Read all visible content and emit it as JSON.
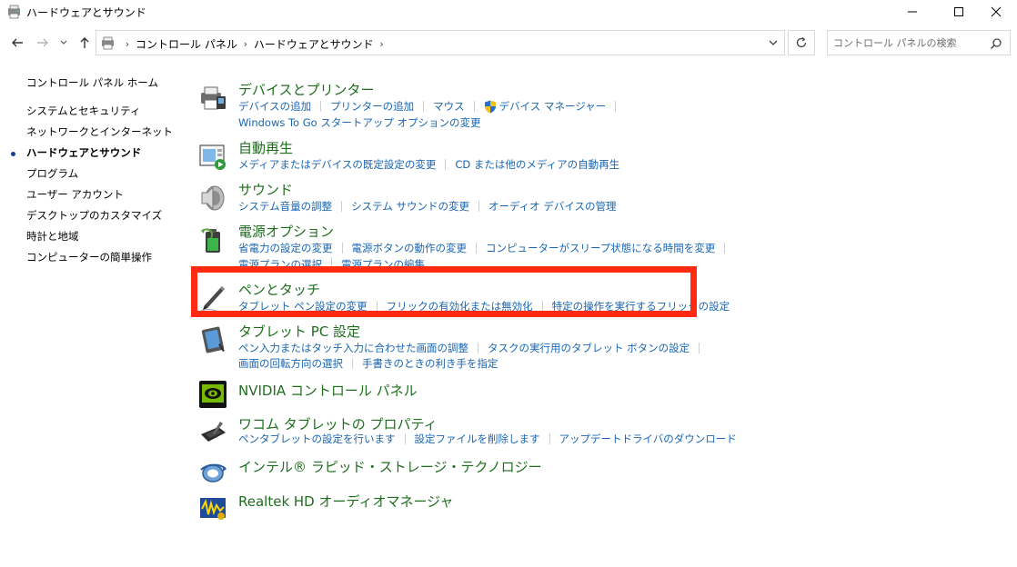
{
  "window": {
    "title": "ハードウェアとサウンド"
  },
  "address": {
    "breadcrumbs": [
      "コントロール パネル",
      "ハードウェアとサウンド"
    ]
  },
  "search": {
    "placeholder": "コントロール パネルの検索"
  },
  "sidebar": {
    "home": "コントロール パネル ホーム",
    "items": [
      {
        "label": "システムとセキュリティ"
      },
      {
        "label": "ネットワークとインターネット"
      },
      {
        "label": "ハードウェアとサウンド",
        "current": true
      },
      {
        "label": "プログラム"
      },
      {
        "label": "ユーザー アカウント"
      },
      {
        "label": "デスクトップのカスタマイズ"
      },
      {
        "label": "時計と地域"
      },
      {
        "label": "コンピューターの簡単操作"
      }
    ]
  },
  "categories": [
    {
      "title": "デバイスとプリンター",
      "icon": "printer-icon",
      "links_row1": [
        "デバイスの追加",
        "プリンターの追加",
        "マウス",
        "デバイス マネージャー"
      ],
      "links_row2": [
        "Windows To Go スタートアップ オプションの変更"
      ]
    },
    {
      "title": "自動再生",
      "icon": "autoplay-icon",
      "links_row1": [
        "メディアまたはデバイスの既定設定の変更",
        "CD または他のメディアの自動再生"
      ]
    },
    {
      "title": "サウンド",
      "icon": "speaker-icon",
      "links_row1": [
        "システム音量の調整",
        "システム サウンドの変更",
        "オーディオ デバイスの管理"
      ]
    },
    {
      "title": "電源オプション",
      "icon": "battery-icon",
      "links_row1": [
        "省電力の設定の変更",
        "電源ボタンの動作の変更",
        "コンピューターがスリープ状態になる時間を変更"
      ],
      "links_row2": [
        "電源プランの選択",
        "電源プランの編集"
      ]
    },
    {
      "title": "ペンとタッチ",
      "icon": "pen-icon",
      "links_row1": [
        "タブレット ペン設定の変更",
        "フリックの有効化または無効化",
        "特定の操作を実行するフリックの設定"
      ]
    },
    {
      "title": "タブレット PC 設定",
      "icon": "tablet-icon",
      "links_row1": [
        "ペン入力またはタッチ入力に合わせた画面の調整",
        "タスクの実行用のタブレット ボタンの設定"
      ],
      "links_row2": [
        "画面の回転方向の選択",
        "手書きのときの利き手を指定"
      ]
    },
    {
      "title": "NVIDIA コントロール パネル",
      "icon": "nvidia-icon",
      "links_row1": []
    },
    {
      "title": "ワコム タブレットの プロパティ",
      "icon": "wacom-icon",
      "links_row1": [
        "ペンタブレットの設定を行います",
        "設定ファイルを削除します",
        "アップデートドライバのダウンロード"
      ]
    },
    {
      "title": "インテル® ラピッド・ストレージ・テクノロジー",
      "icon": "intel-rst-icon",
      "links_row1": []
    },
    {
      "title": "Realtek HD オーディオマネージャ",
      "icon": "realtek-icon",
      "links_row1": []
    }
  ],
  "colors": {
    "category_title": "#1e6e1e",
    "link": "#1a66b3",
    "highlight": "#ff2a10"
  }
}
